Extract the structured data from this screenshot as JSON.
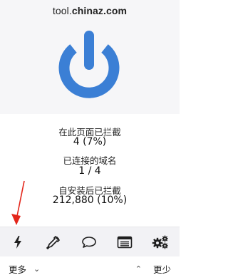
{
  "header": {
    "hostname_prefix": "tool.",
    "hostname_domain": "chinaz.com",
    "power_icon": "power-icon",
    "power_color": "#3b7fd5"
  },
  "stats": {
    "blocked_on_page_label": "在此页面已拦截",
    "blocked_on_page_value": "4 (7%)",
    "domains_connected_label": "已连接的域名",
    "domains_connected_value": "1 / 4",
    "blocked_since_install_label": "自安装后已拦截",
    "blocked_since_install_value": "212,880 (10%)"
  },
  "annotation": {
    "arrow_color": "#e3261b"
  },
  "toolbar": {
    "items": [
      {
        "icon": "lightning-icon"
      },
      {
        "icon": "eyedropper-icon"
      },
      {
        "icon": "chat-bubble-icon"
      },
      {
        "icon": "list-window-icon"
      },
      {
        "icon": "gears-icon"
      }
    ]
  },
  "footer": {
    "more_label": "更多",
    "more_chevron": "⌄",
    "less_label": "更少",
    "less_chevron": "⌃"
  }
}
